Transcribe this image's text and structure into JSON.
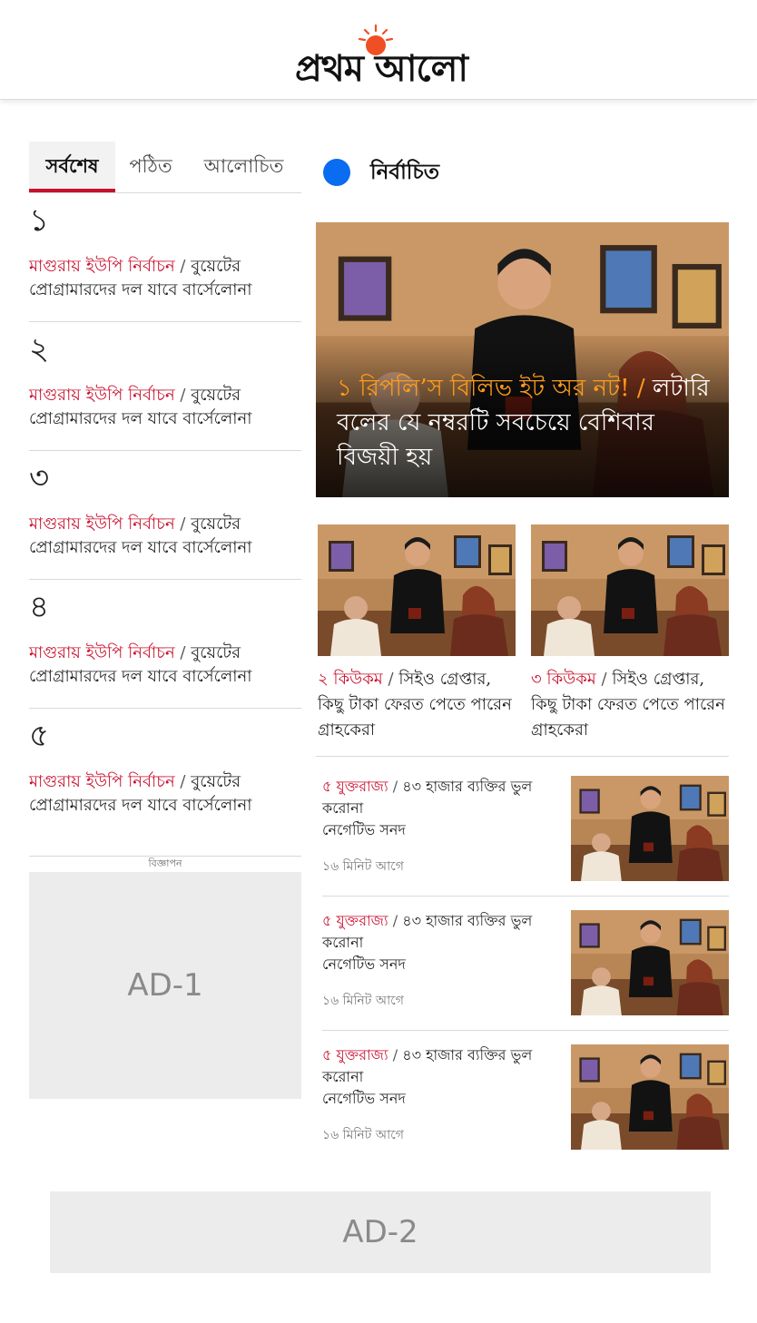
{
  "header": {
    "logo_text": "প্রথম আলো"
  },
  "tabs": [
    {
      "label": "সর্বশেষ",
      "active": true
    },
    {
      "label": "পঠিত",
      "active": false
    },
    {
      "label": "আলোচিত",
      "active": false
    }
  ],
  "ranked": [
    {
      "num": "১",
      "kicker": "মাগুরায় ইউপি নির্বাচন",
      "title": "বুয়েটের প্রোগ্রামারদের দল যাবে বার্সেলোনা"
    },
    {
      "num": "২",
      "kicker": "মাগুরায় ইউপি নির্বাচন",
      "title": "বুয়েটের প্রোগ্রামারদের দল যাবে বার্সেলোনা"
    },
    {
      "num": "৩",
      "kicker": "মাগুরায় ইউপি নির্বাচন",
      "title": "বুয়েটের প্রোগ্রামারদের দল যাবে বার্সেলোনা"
    },
    {
      "num": "৪",
      "kicker": "মাগুরায় ইউপি নির্বাচন",
      "title": "বুয়েটের প্রোগ্রামারদের দল যাবে বার্সেলোনা"
    },
    {
      "num": "৫",
      "kicker": "মাগুরায় ইউপি নির্বাচন",
      "title": "বুয়েটের প্রোগ্রামারদের দল যাবে বার্সেলোনা"
    }
  ],
  "ad1": {
    "label": "বিজ্ঞাপন",
    "text": "AD-1"
  },
  "section": {
    "title": "নির্বাচিত",
    "dot_color": "#0a6cf0"
  },
  "hero": {
    "kicker": "১ রিপলি’স বিলিভ ইট অর নট!",
    "separator": "/",
    "title": "লটারি বলের যে নম্বরটি সবচেয়ে বেশিবার বিজয়ী হয়"
  },
  "cards": [
    {
      "kicker": "২ কিউকম",
      "title": "সিইও গ্রেপ্তার, কিছু টাকা ফেরত পেতে পারেন গ্রাহকেরা"
    },
    {
      "kicker": "৩ কিউকম",
      "title": "সিইও গ্রেপ্তার, কিছু টাকা ফেরত পেতে পারেন গ্রাহকেরা"
    }
  ],
  "list": [
    {
      "kicker": "৫ যুক্তরাজ্য",
      "title_line1": "৪৩ হাজার ব্যক্তির ভুল করোনা",
      "title_line2": "নেগেটিভ সনদ",
      "time": "১৬ মিনিট আগে"
    },
    {
      "kicker": "৫ যুক্তরাজ্য",
      "title_line1": "৪৩ হাজার ব্যক্তির ভুল করোনা",
      "title_line2": "নেগেটিভ সনদ",
      "time": "১৬ মিনিট আগে"
    },
    {
      "kicker": "৫ যুক্তরাজ্য",
      "title_line1": "৪৩ হাজার ব্যক্তির ভুল করোনা",
      "title_line2": "নেগেটিভ সনদ",
      "time": "১৬ মিনিট আগে"
    }
  ],
  "ad2": {
    "text": "AD-2"
  },
  "colors": {
    "accent_red": "#c8102e",
    "hero_orange": "#ff9b1a",
    "logo_sun": "#f04e23"
  }
}
